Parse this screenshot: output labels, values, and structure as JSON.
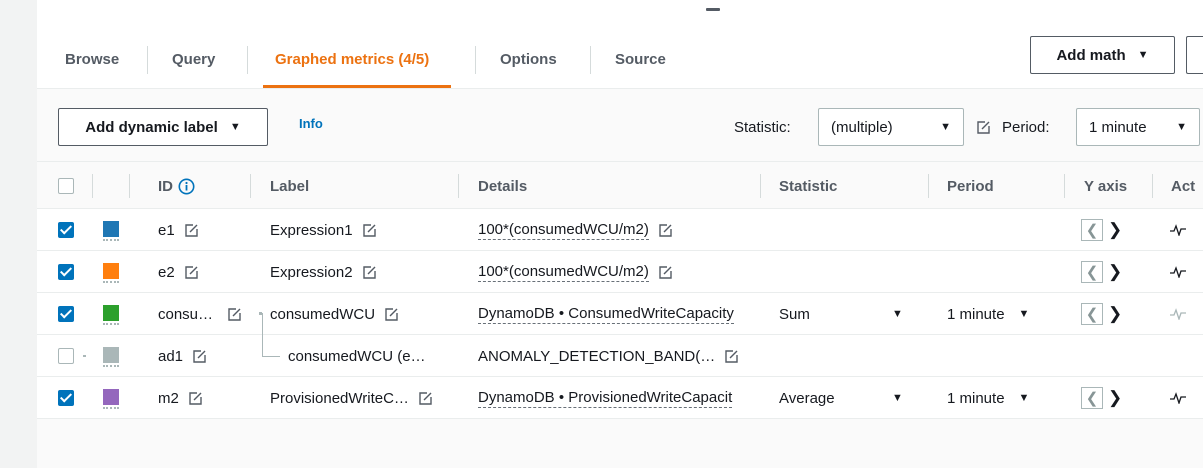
{
  "tabs": [
    {
      "label": "Browse",
      "active": false
    },
    {
      "label": "Query",
      "active": false
    },
    {
      "label": "Graphed metrics (4/5)",
      "active": true
    },
    {
      "label": "Options",
      "active": false
    },
    {
      "label": "Source",
      "active": false
    }
  ],
  "toolbar": {
    "add_math": "Add math",
    "add_dynamic_label": "Add dynamic label",
    "info": "Info",
    "statistic_label": "Statistic:",
    "statistic_value": "(multiple)",
    "period_label": "Period:",
    "period_value": "1 minute"
  },
  "columns": {
    "id": "ID",
    "label": "Label",
    "details": "Details",
    "statistic": "Statistic",
    "period": "Period",
    "yaxis": "Y axis",
    "actions": "Act"
  },
  "colors": {
    "accent": "#ec7211",
    "link": "#0073bb",
    "checkbox": "#0073bb"
  },
  "rows": [
    {
      "checked": true,
      "color": "#1f77b4",
      "id": "e1",
      "label": "Expression1",
      "details": "100*(consumedWCU/m2)",
      "statistic": "",
      "period": "",
      "has_yaxis": true,
      "has_actions": true
    },
    {
      "checked": true,
      "color": "#ff7f0e",
      "id": "e2",
      "label": "Expression2",
      "details": "100*(consumedWCU/m2)",
      "statistic": "",
      "period": "",
      "has_yaxis": true,
      "has_actions": true
    },
    {
      "checked": true,
      "color": "#2ca02c",
      "id": "consu…",
      "label": "consumedWCU",
      "details": "DynamoDB • ConsumedWriteCapacity",
      "statistic": "Sum",
      "period": "1 minute",
      "has_yaxis": true,
      "has_actions": true
    },
    {
      "checked": false,
      "color": "#aab7b8",
      "id": "ad1",
      "label": "consumedWCU (e…",
      "details": "ANOMALY_DETECTION_BAND(…",
      "statistic": "",
      "period": "",
      "has_yaxis": false,
      "has_actions": false
    },
    {
      "checked": true,
      "color": "#9467bd",
      "id": "m2",
      "label": "ProvisionedWriteC…",
      "details": "DynamoDB • ProvisionedWriteCapacit",
      "statistic": "Average",
      "period": "1 minute",
      "has_yaxis": true,
      "has_actions": true
    }
  ]
}
